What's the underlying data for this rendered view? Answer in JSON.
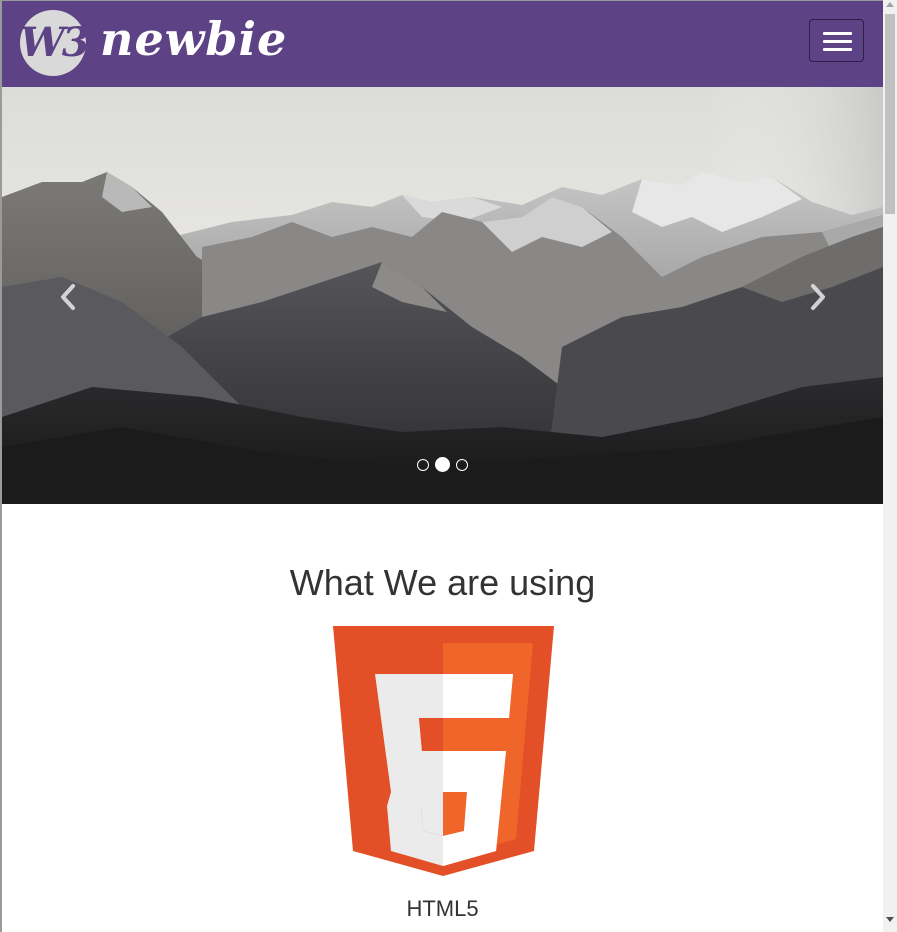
{
  "brand": {
    "monogram": "W3",
    "name": "newbie",
    "navbar_color": "#5d4285"
  },
  "navbar": {
    "toggle_icon": "hamburger-menu-icon"
  },
  "carousel": {
    "active_slide": 2,
    "slide_count": 3,
    "prev_icon": "chevron-left-icon",
    "next_icon": "chevron-right-icon",
    "image": "mountain-range-photo"
  },
  "section": {
    "title": "What We are using",
    "tech": {
      "label": "HTML5",
      "icon": "html5-logo-icon",
      "colors": {
        "outer": "#e34f26",
        "inner": "#ef652a",
        "glyph": "#ebebeb",
        "glyph_light": "#ffffff"
      }
    }
  }
}
